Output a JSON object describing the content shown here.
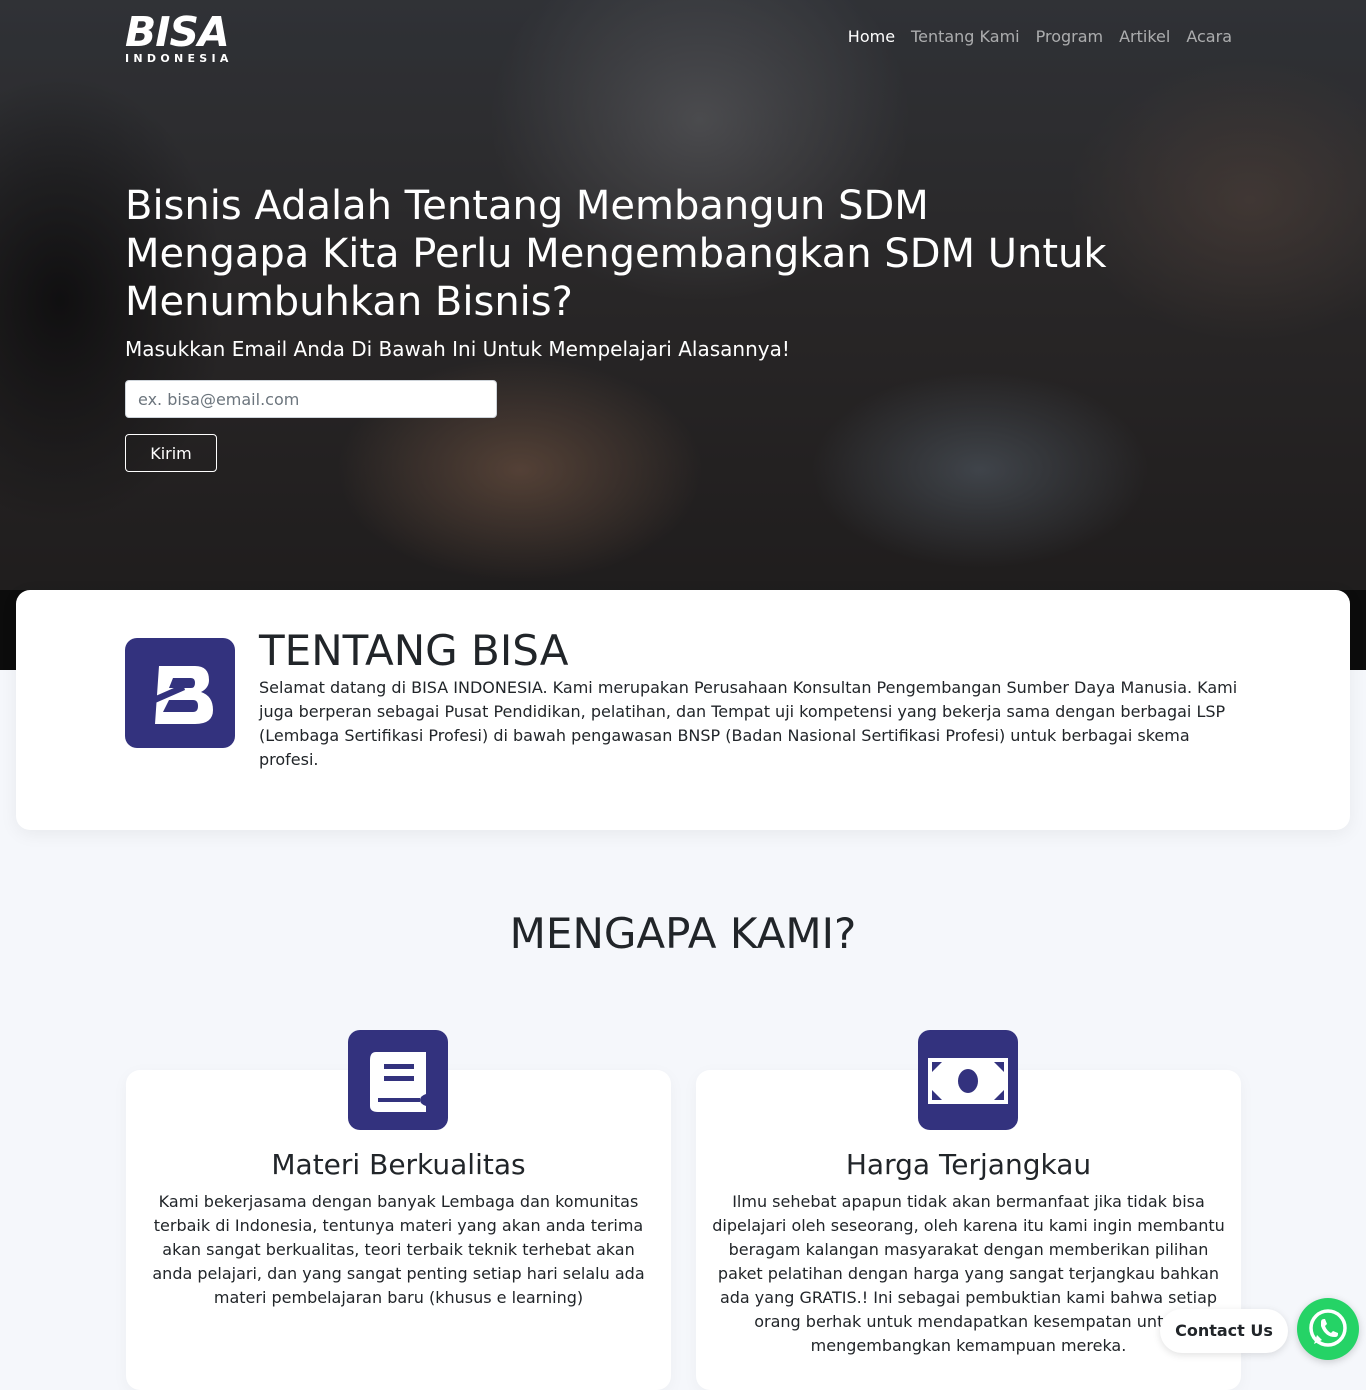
{
  "brand": {
    "name": "BISA",
    "sub": "INDONESIA"
  },
  "nav": {
    "items": [
      {
        "label": "Home",
        "active": true
      },
      {
        "label": "Tentang Kami",
        "active": false
      },
      {
        "label": "Program",
        "active": false
      },
      {
        "label": "Artikel",
        "active": false
      },
      {
        "label": "Acara",
        "active": false
      }
    ]
  },
  "hero": {
    "title_line1": "Bisnis Adalah Tentang Membangun SDM",
    "title_line2": "Mengapa Kita Perlu Mengembangkan SDM Untuk Menumbuhkan Bisnis?",
    "subtitle": "Masukkan Email Anda Di Bawah Ini Untuk Mempelajari Alasannya!",
    "email_placeholder": "ex. bisa@email.com",
    "email_value": "",
    "submit_label": "Kirim"
  },
  "about": {
    "title": "TENTANG BISA",
    "text": "Selamat datang di BISA INDONESIA. Kami merupakan Perusahaan Konsultan Pengembangan Sumber Daya Manusia. Kami juga berperan sebagai Pusat Pendidikan, pelatihan, dan Tempat uji kompetensi yang bekerja sama dengan berbagai LSP (Lembaga Sertifikasi Profesi) di bawah pengawasan BNSP (Badan Nasional Sertifikasi Profesi) untuk berbagai skema profesi."
  },
  "why": {
    "title": "MENGAPA KAMI?",
    "features": [
      {
        "icon": "book-icon",
        "title": "Materi Berkualitas",
        "text": "Kami bekerjasama dengan banyak Lembaga dan komunitas terbaik di Indonesia, tentunya materi yang akan anda terima akan sangat berkualitas, teori terbaik teknik terhebat akan anda pelajari, dan yang sangat penting setiap hari selalu ada materi pembelajaran baru (khusus e learning)"
      },
      {
        "icon": "money-bill-icon",
        "title": "Harga Terjangkau",
        "text": "Ilmu sehebat apapun tidak akan bermanfaat jika tidak bisa dipelajari oleh seseorang, oleh karena itu kami ingin membantu beragam kalangan masyarakat dengan memberikan pilihan paket pelatihan dengan harga yang sangat terjangkau bahkan ada yang GRATIS.! Ini sebagai pembuktian kami bahwa setiap orang berhak untuk mendapatkan kesempatan untuk mengembangkan kemampuan mereka."
      }
    ]
  },
  "contact": {
    "label": "Contact Us",
    "icon": "whatsapp-icon"
  },
  "colors": {
    "brand": "#33327e",
    "whatsapp": "#25d366",
    "page_bg": "#f5f7fb"
  }
}
